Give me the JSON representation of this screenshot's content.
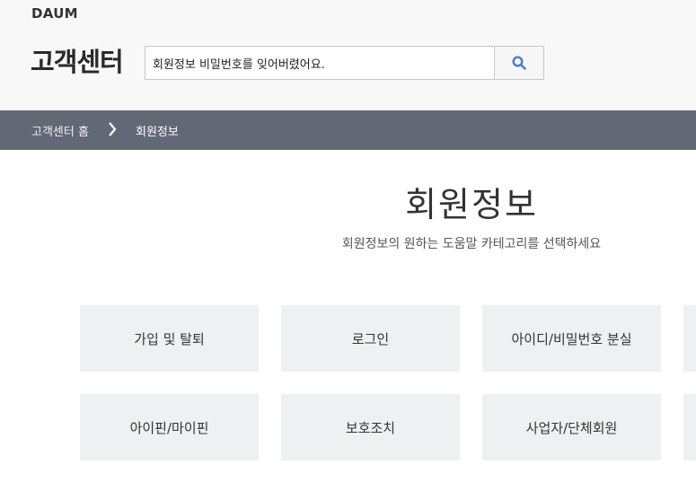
{
  "header": {
    "logo": "DAUM",
    "site_title": "고객센터",
    "search": {
      "value": "회원정보 비밀번호를 잊어버렸어요."
    }
  },
  "icons": {
    "search": "search-icon",
    "separator": "chevron-right-icon"
  },
  "colors": {
    "accent": "#4a7bd0",
    "breadcrumb_bg": "#626875",
    "tile_bg": "#eff0f2"
  },
  "breadcrumb": {
    "home": "고객센터 홈",
    "current": "회원정보"
  },
  "main": {
    "title": "회원정보",
    "description": "회원정보의 원하는 도움말 카테고리를 선택하세요"
  },
  "categories": [
    "가입 및 탈퇴",
    "로그인",
    "아이디/비밀번호 분실",
    "아이핀/마이핀",
    "보호조치",
    "사업자/단체회원"
  ]
}
